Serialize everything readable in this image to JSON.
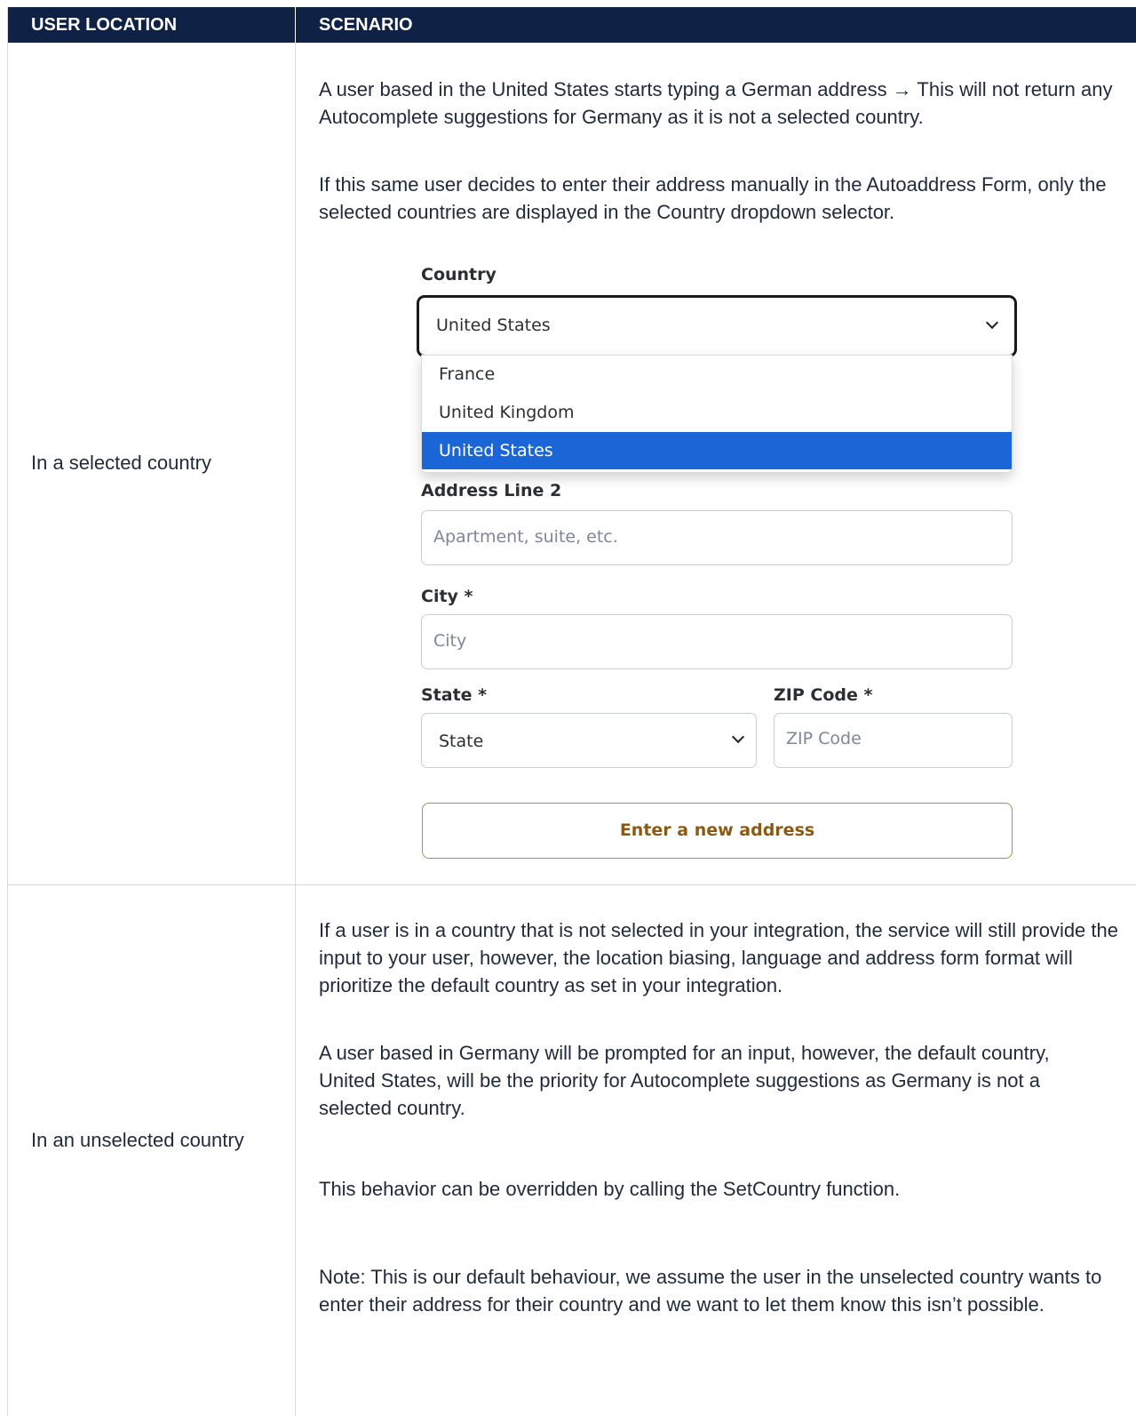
{
  "table": {
    "headers": [
      "USER LOCATION",
      "SCENARIO"
    ],
    "rows": [
      {
        "location": "In a selected country",
        "paragraphs": [
          "A user based in the United States starts typing a German address → This will not return any Autocomplete suggestions for Germany as it is not a selected country.",
          "If this same user decides to enter their address manually in the Autoaddress Form, only the selected countries are displayed in the Country dropdown selector."
        ]
      },
      {
        "location": "In an unselected country",
        "paragraphs": [
          "If a user is in a country that is not selected in your integration, the service will still provide the input to your user, however, the location biasing, language and address form format will prioritize the default country as set in your integration.",
          "A user based in Germany will be prompted for an input, however, the default country, United States, will be the priority for Autocomplete suggestions as Germany is not a selected country.",
          "This behavior can be overridden by calling the SetCountry function.",
          "Note: This is our default behaviour, we assume the user in the unselected country wants to enter their address for their country and we want to let them know this isn’t possible."
        ]
      }
    ]
  },
  "form": {
    "country_label": "Country",
    "country_value": "United States",
    "country_options": [
      "France",
      "United Kingdom",
      "United States"
    ],
    "selected_option": "United States",
    "address_line2_label": "Address Line 2",
    "address_line2_placeholder": "Apartment, suite, etc.",
    "city_label": "City *",
    "city_placeholder": "City",
    "state_label": "State *",
    "state_value": "State",
    "zip_label": "ZIP Code *",
    "zip_placeholder": "ZIP Code",
    "new_address_button": "Enter a new address"
  },
  "colors": {
    "header_bg": "#0f2145",
    "header_text": "#ffffff",
    "option_highlight": "#1b66d6",
    "button_text": "#8a5a14",
    "button_border": "#b88a3a"
  },
  "icons": [
    "chevron-down-icon"
  ]
}
